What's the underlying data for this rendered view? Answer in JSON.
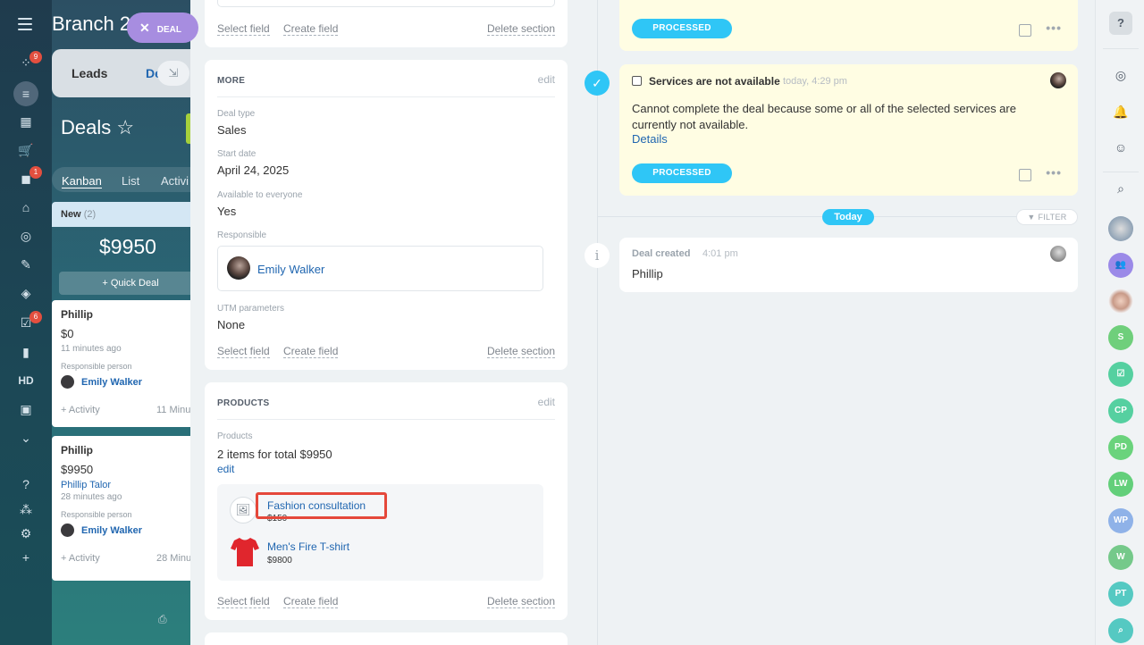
{
  "left_nav": {
    "badges": {
      "feed": "9",
      "robots": "1",
      "tasks": "6"
    },
    "hd_label": "HD"
  },
  "background": {
    "branch_title": "Branch 2",
    "deal_pill": "DEAL",
    "tabs": {
      "leads": "Leads",
      "deals": "De"
    },
    "deals_title": "Deals ☆",
    "view_tabs": [
      "Kanban",
      "List",
      "Activi"
    ],
    "column": {
      "name": "New",
      "count": "(2)",
      "total": "$9950",
      "quick_deal": "+ Quick Deal"
    },
    "cards": [
      {
        "title": "Phillip",
        "amount": "$0",
        "meta": "11 minutes ago",
        "contact": "",
        "resp_label": "Responsible person",
        "resp_name": "Emily Walker",
        "footer": "+ Activity",
        "footer_right": "11 Minu"
      },
      {
        "title": "Phillip",
        "amount": "$9950",
        "meta": "28 minutes ago",
        "contact": "Phillip Talor",
        "resp_label": "Responsible person",
        "resp_name": "Emily Walker",
        "footer": "+ Activity",
        "footer_right": "28 Minu"
      }
    ]
  },
  "top_section": {
    "select_field": "Select field",
    "create_field": "Create field",
    "delete_section": "Delete section"
  },
  "more_section": {
    "header": "MORE",
    "edit": "edit",
    "fields": [
      {
        "label": "Deal type",
        "value": "Sales"
      },
      {
        "label": "Start date",
        "value": "April 24, 2025"
      },
      {
        "label": "Available to everyone",
        "value": "Yes"
      }
    ],
    "responsible_label": "Responsible",
    "responsible_name": "Emily Walker",
    "utm_label": "UTM parameters",
    "utm_value": "None",
    "select_field": "Select field",
    "create_field": "Create field",
    "delete_section": "Delete section"
  },
  "products_section": {
    "header": "PRODUCTS",
    "edit": "edit",
    "label": "Products",
    "summary": "2 items for total $9950",
    "summary_edit": "edit",
    "items": [
      {
        "name": "Fashion consultation",
        "price": "$150"
      },
      {
        "name": "Men's Fire T-shirt",
        "price": "$9800"
      }
    ],
    "select_field": "Select field",
    "create_field": "Create field",
    "delete_section": "Delete section"
  },
  "timeline": {
    "card1": {
      "status": "PROCESSED"
    },
    "task": {
      "title": "Services are not available",
      "time": "today, 4:29 pm",
      "body": "Cannot complete the deal because some or all of the selected services are currently not available.",
      "details": "Details",
      "status": "PROCESSED"
    },
    "today": "Today",
    "filter": "FILTER",
    "created": {
      "title": "Deal created",
      "time": "4:01 pm",
      "body": "Phillip"
    }
  },
  "right_bar": {
    "help": "?",
    "avatars": [
      {
        "initials": "S",
        "color": "#6fcf7b"
      },
      {
        "initials": "CP",
        "color": "#55d0a0"
      },
      {
        "initials": "PD",
        "color": "#6ad37c"
      },
      {
        "initials": "LW",
        "color": "#63cf7a"
      },
      {
        "initials": "WP",
        "color": "#8fb2e8"
      },
      {
        "initials": "W",
        "color": "#75c98a"
      },
      {
        "initials": "PT",
        "color": "#55c9c2"
      }
    ]
  },
  "colors": {
    "accent": "#2fc6f6",
    "link": "#2066b0",
    "highlight": "#e5483a",
    "task_card": "#fffde3"
  }
}
